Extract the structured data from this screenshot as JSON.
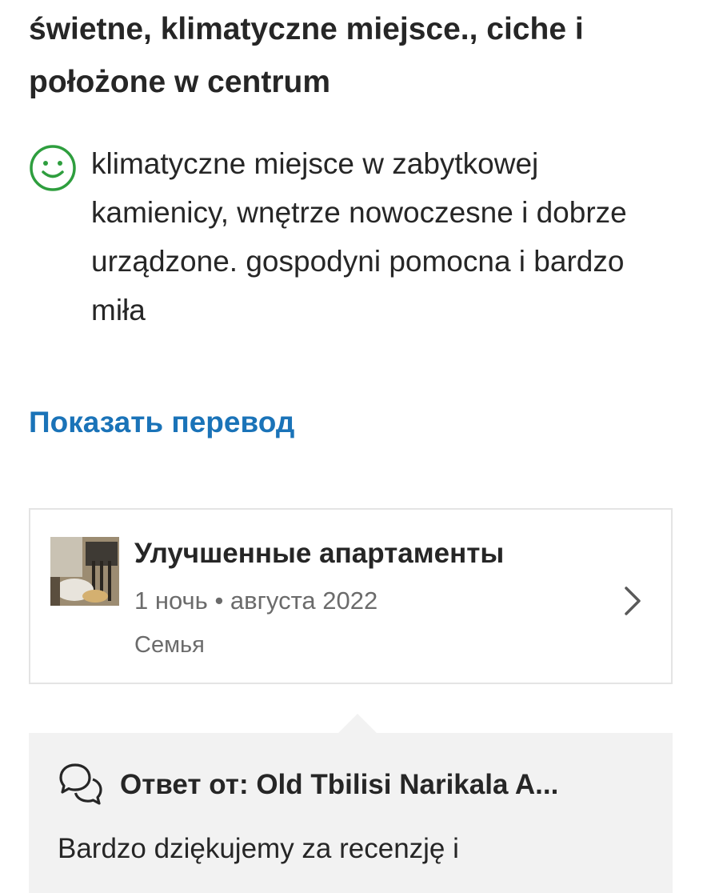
{
  "review": {
    "title": "świetne, klimatyczne miejsce., ciche i położone w centrum",
    "positive_icon": "smile-icon",
    "positive_text": "klimatyczne miejsce w zabytkowej kamienicy, wnętrze nowoczesne i dobrze urządzone. gospodyni pomocna i bardzo miła",
    "show_translation_label": "Показать перевод"
  },
  "stay_card": {
    "room_name": "Улучшенные апартаменты",
    "stay_details": "1 ночь • августа 2022",
    "traveler_type": "Семья",
    "chevron_icon": "chevron-right-icon"
  },
  "owner_response": {
    "icon": "chat-bubbles-icon",
    "heading": "Ответ от: Old Tbilisi Narikala A...",
    "text": "Bardzo dziękujemy za recenzję i"
  },
  "colors": {
    "link": "#1a73b8",
    "positive_icon": "#2e9e3e",
    "text": "#262626",
    "muted": "#6b6b6b",
    "response_bg": "#f2f2f2"
  }
}
